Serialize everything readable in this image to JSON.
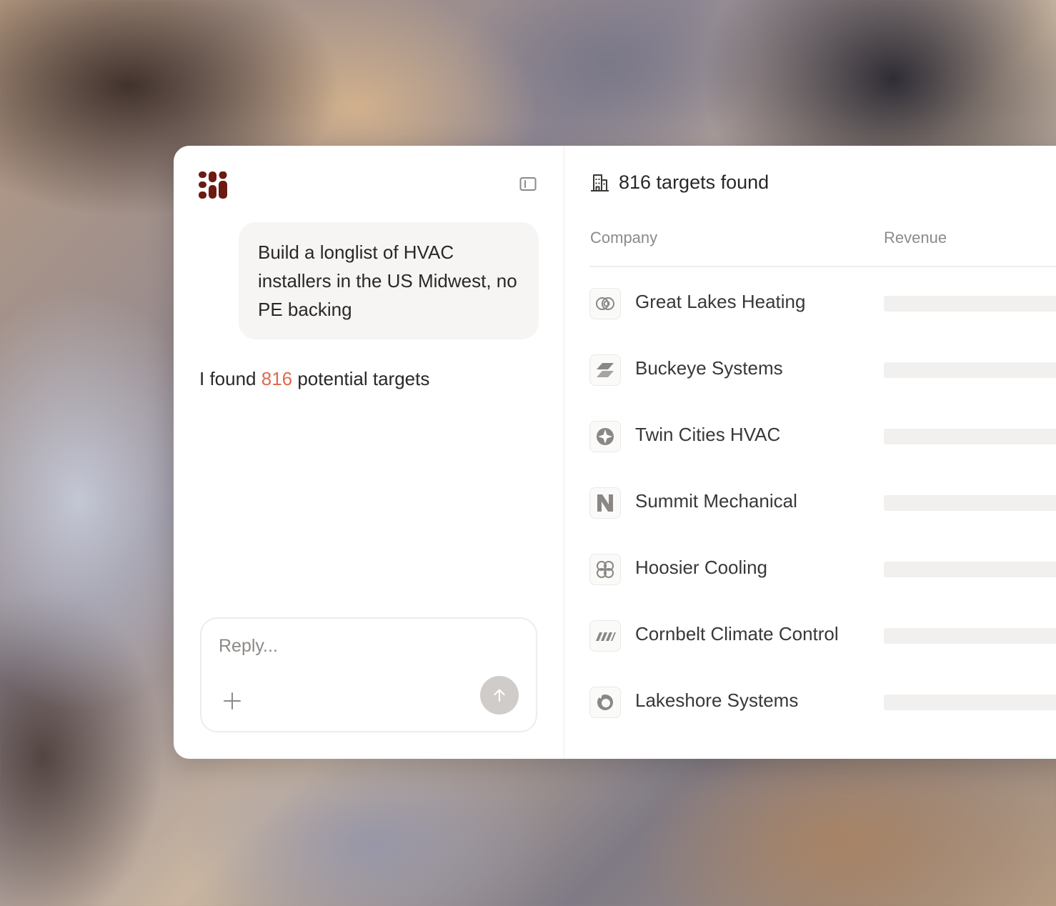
{
  "chat": {
    "user_message": "Build a longlist of HVAC installers in the US Midwest, no PE backing",
    "assistant_prefix": "I found ",
    "assistant_count": "816",
    "assistant_suffix": " potential targets",
    "reply_placeholder": "Reply..."
  },
  "results": {
    "title": "816 targets found",
    "columns": {
      "company": "Company",
      "revenue": "Revenue"
    },
    "companies": [
      {
        "name": "Great Lakes Heating",
        "logo_icon": "overlapping-circles-icon"
      },
      {
        "name": "Buckeye Systems",
        "logo_icon": "slanted-planes-icon"
      },
      {
        "name": "Twin Cities HVAC",
        "logo_icon": "compass-star-icon"
      },
      {
        "name": "Summit Mechanical",
        "logo_icon": "letter-n-icon"
      },
      {
        "name": "Hoosier Cooling",
        "logo_icon": "clover-icon"
      },
      {
        "name": "Cornbelt Climate Control",
        "logo_icon": "diagonal-stripes-icon"
      },
      {
        "name": "Lakeshore Systems",
        "logo_icon": "ring-icon"
      }
    ]
  },
  "colors": {
    "accent": "#e0694f",
    "brand": "#6b1a14",
    "send_button": "#cfccc9",
    "bubble": "#f6f5f4",
    "skeleton": "#f1f0ef"
  }
}
